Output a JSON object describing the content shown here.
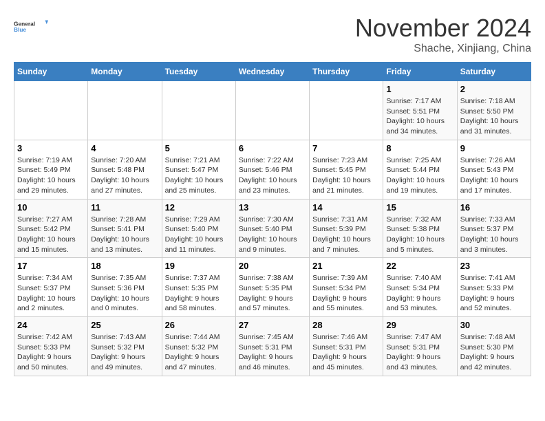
{
  "header": {
    "logo_line1": "General",
    "logo_line2": "Blue",
    "month": "November 2024",
    "location": "Shache, Xinjiang, China"
  },
  "weekdays": [
    "Sunday",
    "Monday",
    "Tuesday",
    "Wednesday",
    "Thursday",
    "Friday",
    "Saturday"
  ],
  "weeks": [
    [
      {
        "day": "",
        "info": ""
      },
      {
        "day": "",
        "info": ""
      },
      {
        "day": "",
        "info": ""
      },
      {
        "day": "",
        "info": ""
      },
      {
        "day": "",
        "info": ""
      },
      {
        "day": "1",
        "info": "Sunrise: 7:17 AM\nSunset: 5:51 PM\nDaylight: 10 hours and 34 minutes."
      },
      {
        "day": "2",
        "info": "Sunrise: 7:18 AM\nSunset: 5:50 PM\nDaylight: 10 hours and 31 minutes."
      }
    ],
    [
      {
        "day": "3",
        "info": "Sunrise: 7:19 AM\nSunset: 5:49 PM\nDaylight: 10 hours and 29 minutes."
      },
      {
        "day": "4",
        "info": "Sunrise: 7:20 AM\nSunset: 5:48 PM\nDaylight: 10 hours and 27 minutes."
      },
      {
        "day": "5",
        "info": "Sunrise: 7:21 AM\nSunset: 5:47 PM\nDaylight: 10 hours and 25 minutes."
      },
      {
        "day": "6",
        "info": "Sunrise: 7:22 AM\nSunset: 5:46 PM\nDaylight: 10 hours and 23 minutes."
      },
      {
        "day": "7",
        "info": "Sunrise: 7:23 AM\nSunset: 5:45 PM\nDaylight: 10 hours and 21 minutes."
      },
      {
        "day": "8",
        "info": "Sunrise: 7:25 AM\nSunset: 5:44 PM\nDaylight: 10 hours and 19 minutes."
      },
      {
        "day": "9",
        "info": "Sunrise: 7:26 AM\nSunset: 5:43 PM\nDaylight: 10 hours and 17 minutes."
      }
    ],
    [
      {
        "day": "10",
        "info": "Sunrise: 7:27 AM\nSunset: 5:42 PM\nDaylight: 10 hours and 15 minutes."
      },
      {
        "day": "11",
        "info": "Sunrise: 7:28 AM\nSunset: 5:41 PM\nDaylight: 10 hours and 13 minutes."
      },
      {
        "day": "12",
        "info": "Sunrise: 7:29 AM\nSunset: 5:40 PM\nDaylight: 10 hours and 11 minutes."
      },
      {
        "day": "13",
        "info": "Sunrise: 7:30 AM\nSunset: 5:40 PM\nDaylight: 10 hours and 9 minutes."
      },
      {
        "day": "14",
        "info": "Sunrise: 7:31 AM\nSunset: 5:39 PM\nDaylight: 10 hours and 7 minutes."
      },
      {
        "day": "15",
        "info": "Sunrise: 7:32 AM\nSunset: 5:38 PM\nDaylight: 10 hours and 5 minutes."
      },
      {
        "day": "16",
        "info": "Sunrise: 7:33 AM\nSunset: 5:37 PM\nDaylight: 10 hours and 3 minutes."
      }
    ],
    [
      {
        "day": "17",
        "info": "Sunrise: 7:34 AM\nSunset: 5:37 PM\nDaylight: 10 hours and 2 minutes."
      },
      {
        "day": "18",
        "info": "Sunrise: 7:35 AM\nSunset: 5:36 PM\nDaylight: 10 hours and 0 minutes."
      },
      {
        "day": "19",
        "info": "Sunrise: 7:37 AM\nSunset: 5:35 PM\nDaylight: 9 hours and 58 minutes."
      },
      {
        "day": "20",
        "info": "Sunrise: 7:38 AM\nSunset: 5:35 PM\nDaylight: 9 hours and 57 minutes."
      },
      {
        "day": "21",
        "info": "Sunrise: 7:39 AM\nSunset: 5:34 PM\nDaylight: 9 hours and 55 minutes."
      },
      {
        "day": "22",
        "info": "Sunrise: 7:40 AM\nSunset: 5:34 PM\nDaylight: 9 hours and 53 minutes."
      },
      {
        "day": "23",
        "info": "Sunrise: 7:41 AM\nSunset: 5:33 PM\nDaylight: 9 hours and 52 minutes."
      }
    ],
    [
      {
        "day": "24",
        "info": "Sunrise: 7:42 AM\nSunset: 5:33 PM\nDaylight: 9 hours and 50 minutes."
      },
      {
        "day": "25",
        "info": "Sunrise: 7:43 AM\nSunset: 5:32 PM\nDaylight: 9 hours and 49 minutes."
      },
      {
        "day": "26",
        "info": "Sunrise: 7:44 AM\nSunset: 5:32 PM\nDaylight: 9 hours and 47 minutes."
      },
      {
        "day": "27",
        "info": "Sunrise: 7:45 AM\nSunset: 5:31 PM\nDaylight: 9 hours and 46 minutes."
      },
      {
        "day": "28",
        "info": "Sunrise: 7:46 AM\nSunset: 5:31 PM\nDaylight: 9 hours and 45 minutes."
      },
      {
        "day": "29",
        "info": "Sunrise: 7:47 AM\nSunset: 5:31 PM\nDaylight: 9 hours and 43 minutes."
      },
      {
        "day": "30",
        "info": "Sunrise: 7:48 AM\nSunset: 5:30 PM\nDaylight: 9 hours and 42 minutes."
      }
    ]
  ]
}
